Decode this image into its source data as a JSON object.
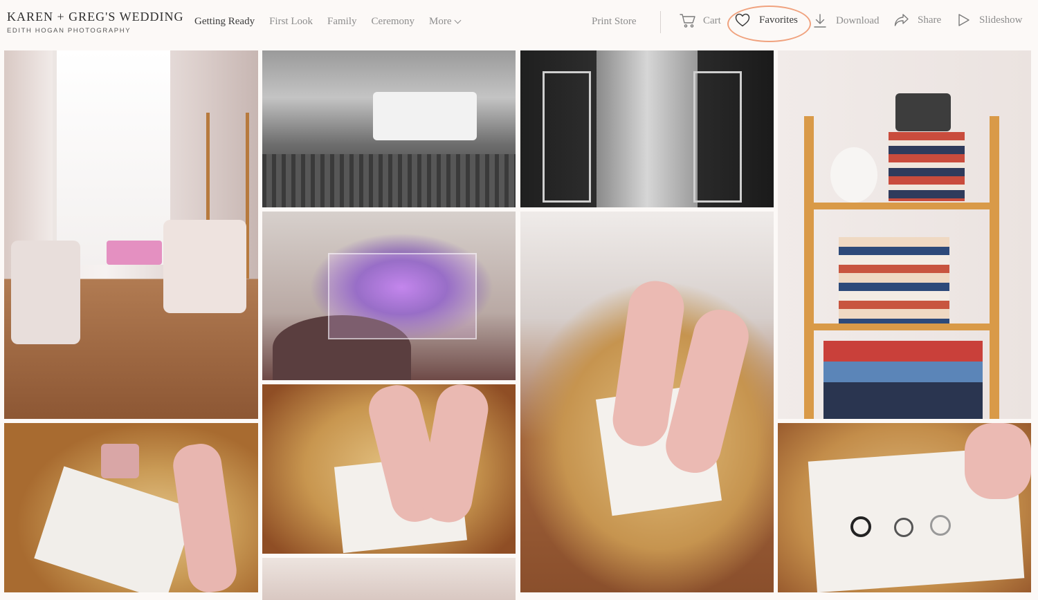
{
  "brand": {
    "title": "KAREN + GREG'S WEDDING",
    "subtitle": "EDITH HOGAN PHOTOGRAPHY"
  },
  "nav": {
    "items": [
      {
        "label": "Getting Ready"
      },
      {
        "label": "First Look"
      },
      {
        "label": "Family"
      },
      {
        "label": "Ceremony"
      },
      {
        "label": "More"
      }
    ]
  },
  "actions": {
    "print_store": "Print Store",
    "cart": "Cart",
    "favorites": "Favorites",
    "download": "Download",
    "share": "Share",
    "slideshow": "Slideshow"
  },
  "icons": {
    "cart": "cart-icon",
    "favorites": "heart-icon",
    "download": "download-icon",
    "share": "share-icon",
    "slideshow": "play-icon",
    "more": "chevron-down-icon"
  },
  "colors": {
    "background": "#fcf9f7",
    "active_nav": "#3a3a3a",
    "muted_nav": "#8d8d8d",
    "highlight_ring": "#f0a27e"
  },
  "gallery": {
    "photos": [
      {
        "name": "living-room-chairs",
        "style": "warm"
      },
      {
        "name": "groomsmen-truck",
        "style": "bw"
      },
      {
        "name": "doorway-room",
        "style": "bw"
      },
      {
        "name": "bookshelf-camera",
        "style": "warm"
      },
      {
        "name": "neon-sign",
        "style": "neon"
      },
      {
        "name": "shoes-on-stool",
        "style": "gold"
      },
      {
        "name": "rings-invitation",
        "style": "gold"
      },
      {
        "name": "shoes-invitation",
        "style": "gold"
      },
      {
        "name": "rings-closeup",
        "style": "gold"
      },
      {
        "name": "blurred-flowers",
        "style": "soft"
      }
    ]
  }
}
